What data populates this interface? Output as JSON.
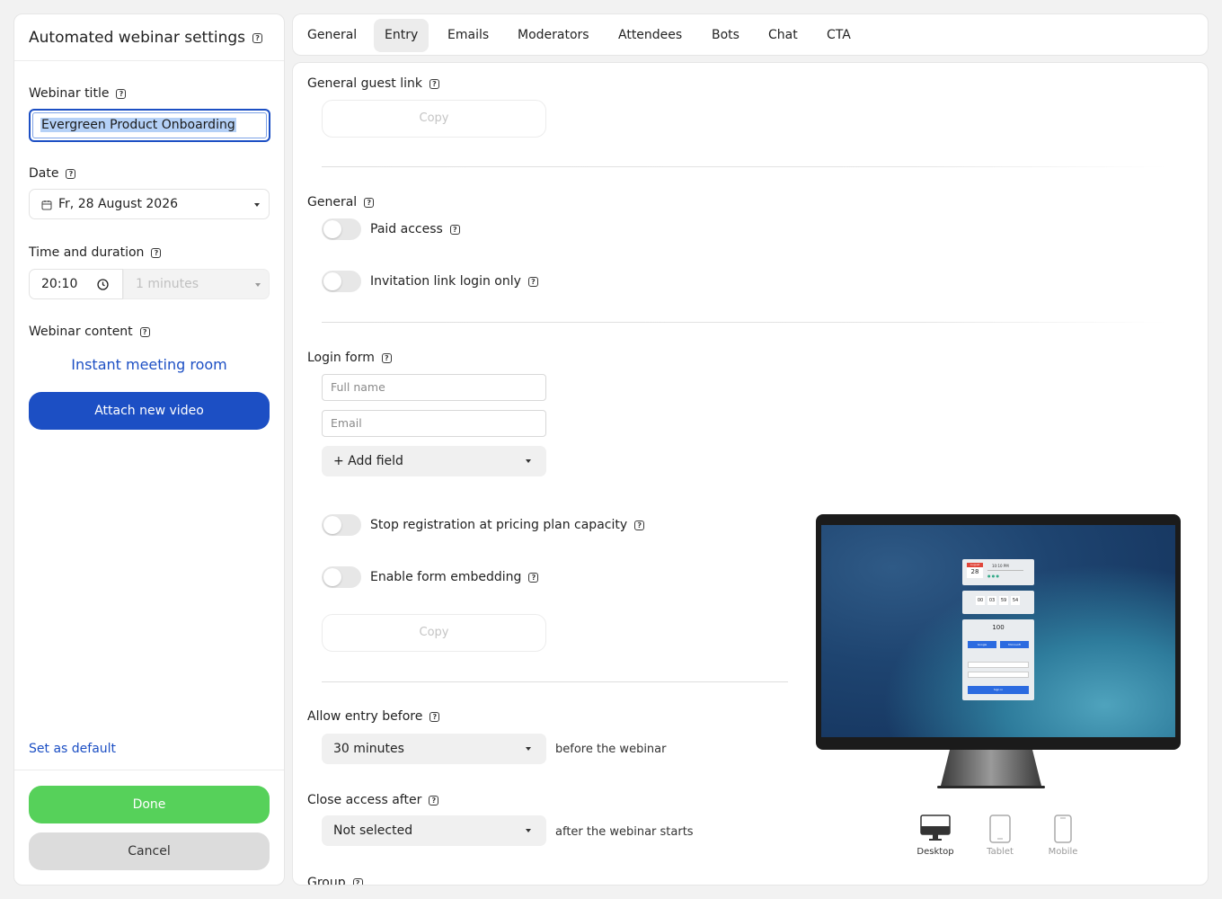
{
  "sidebar": {
    "title": "Automated webinar settings",
    "webinar_title_label": "Webinar title",
    "webinar_title_value": "Evergreen Product Onboarding",
    "date_label": "Date",
    "date_value": "Fr, 28 August 2026",
    "time_label": "Time and duration",
    "time_value": "20:10",
    "duration_placeholder": "1 minutes",
    "content_label": "Webinar content",
    "content_link": "Instant meeting room",
    "attach_button": "Attach new video",
    "set_default": "Set as default",
    "done_button": "Done",
    "cancel_button": "Cancel"
  },
  "tabs": [
    "General",
    "Entry",
    "Emails",
    "Moderators",
    "Attendees",
    "Bots",
    "Chat",
    "CTA"
  ],
  "active_tab": "Entry",
  "entry": {
    "guest_link_label": "General guest link",
    "copy_label": "Copy",
    "general_label": "General",
    "paid_access": "Paid access",
    "invitation_only": "Invitation link login only",
    "login_form_label": "Login form",
    "full_name_placeholder": "Full name",
    "email_placeholder": "Email",
    "add_field": "+ Add field",
    "stop_registration": "Stop registration at pricing plan capacity",
    "enable_embedding": "Enable form embedding",
    "copy_label_2": "Copy",
    "allow_entry_label": "Allow entry before",
    "allow_entry_value": "30 minutes",
    "allow_entry_note": "before the webinar",
    "close_access_label": "Close access after",
    "close_access_value": "Not selected",
    "close_access_note": "after the webinar starts",
    "group_label": "Group"
  },
  "preview": {
    "month": "August",
    "day": "28",
    "time": "10:10 PM",
    "countdown": [
      "00",
      "03",
      "59",
      "54"
    ],
    "seats": "100",
    "google": "Google",
    "microsoft": "Microsoft",
    "signin": "Sign in",
    "devices": [
      "Desktop",
      "Tablet",
      "Mobile"
    ],
    "active_device": "Desktop"
  },
  "colors": {
    "primary": "#1c4fc4",
    "link": "#1c4fc4",
    "done": "#56d15a",
    "cancel": "#dcdcdc"
  }
}
